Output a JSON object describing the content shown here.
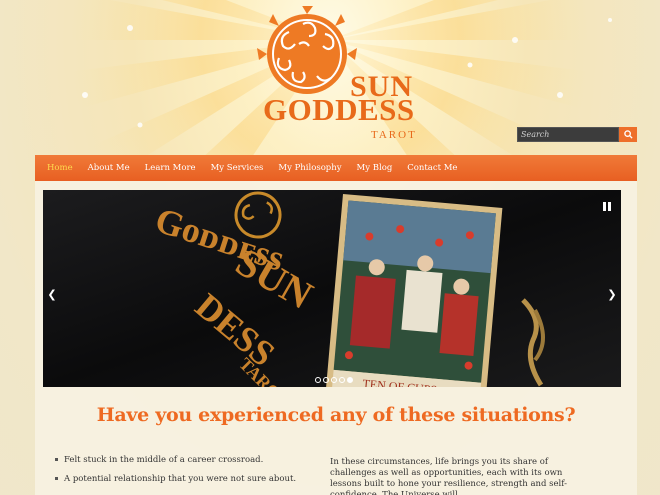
{
  "brand": {
    "logo_word1": "SUN",
    "logo_word2": "GODDESS",
    "logo_word3": "TAROT",
    "accent": "#e86a1a"
  },
  "search": {
    "placeholder": "Search",
    "icon": "search-icon"
  },
  "nav": {
    "items": [
      {
        "label": "Home",
        "active": true
      },
      {
        "label": "About Me"
      },
      {
        "label": "Learn More"
      },
      {
        "label": "My Services"
      },
      {
        "label": "My Philosophy"
      },
      {
        "label": "My Blog"
      },
      {
        "label": "Contact Me"
      }
    ]
  },
  "slider": {
    "slide_count": 4,
    "active_slide": 4,
    "card_text": "TEN OF CUPS"
  },
  "main": {
    "headline": "Have you experienced any of these situations?",
    "bullets": [
      "Felt stuck in the middle of a career crossroad.",
      "A potential relationship that you were not sure about."
    ],
    "paragraph": "In these circumstances, life brings you its share of challenges as well as opportunities, each with its own lessons built to hone your resilience, strength and self-confidence. The Universe will"
  }
}
